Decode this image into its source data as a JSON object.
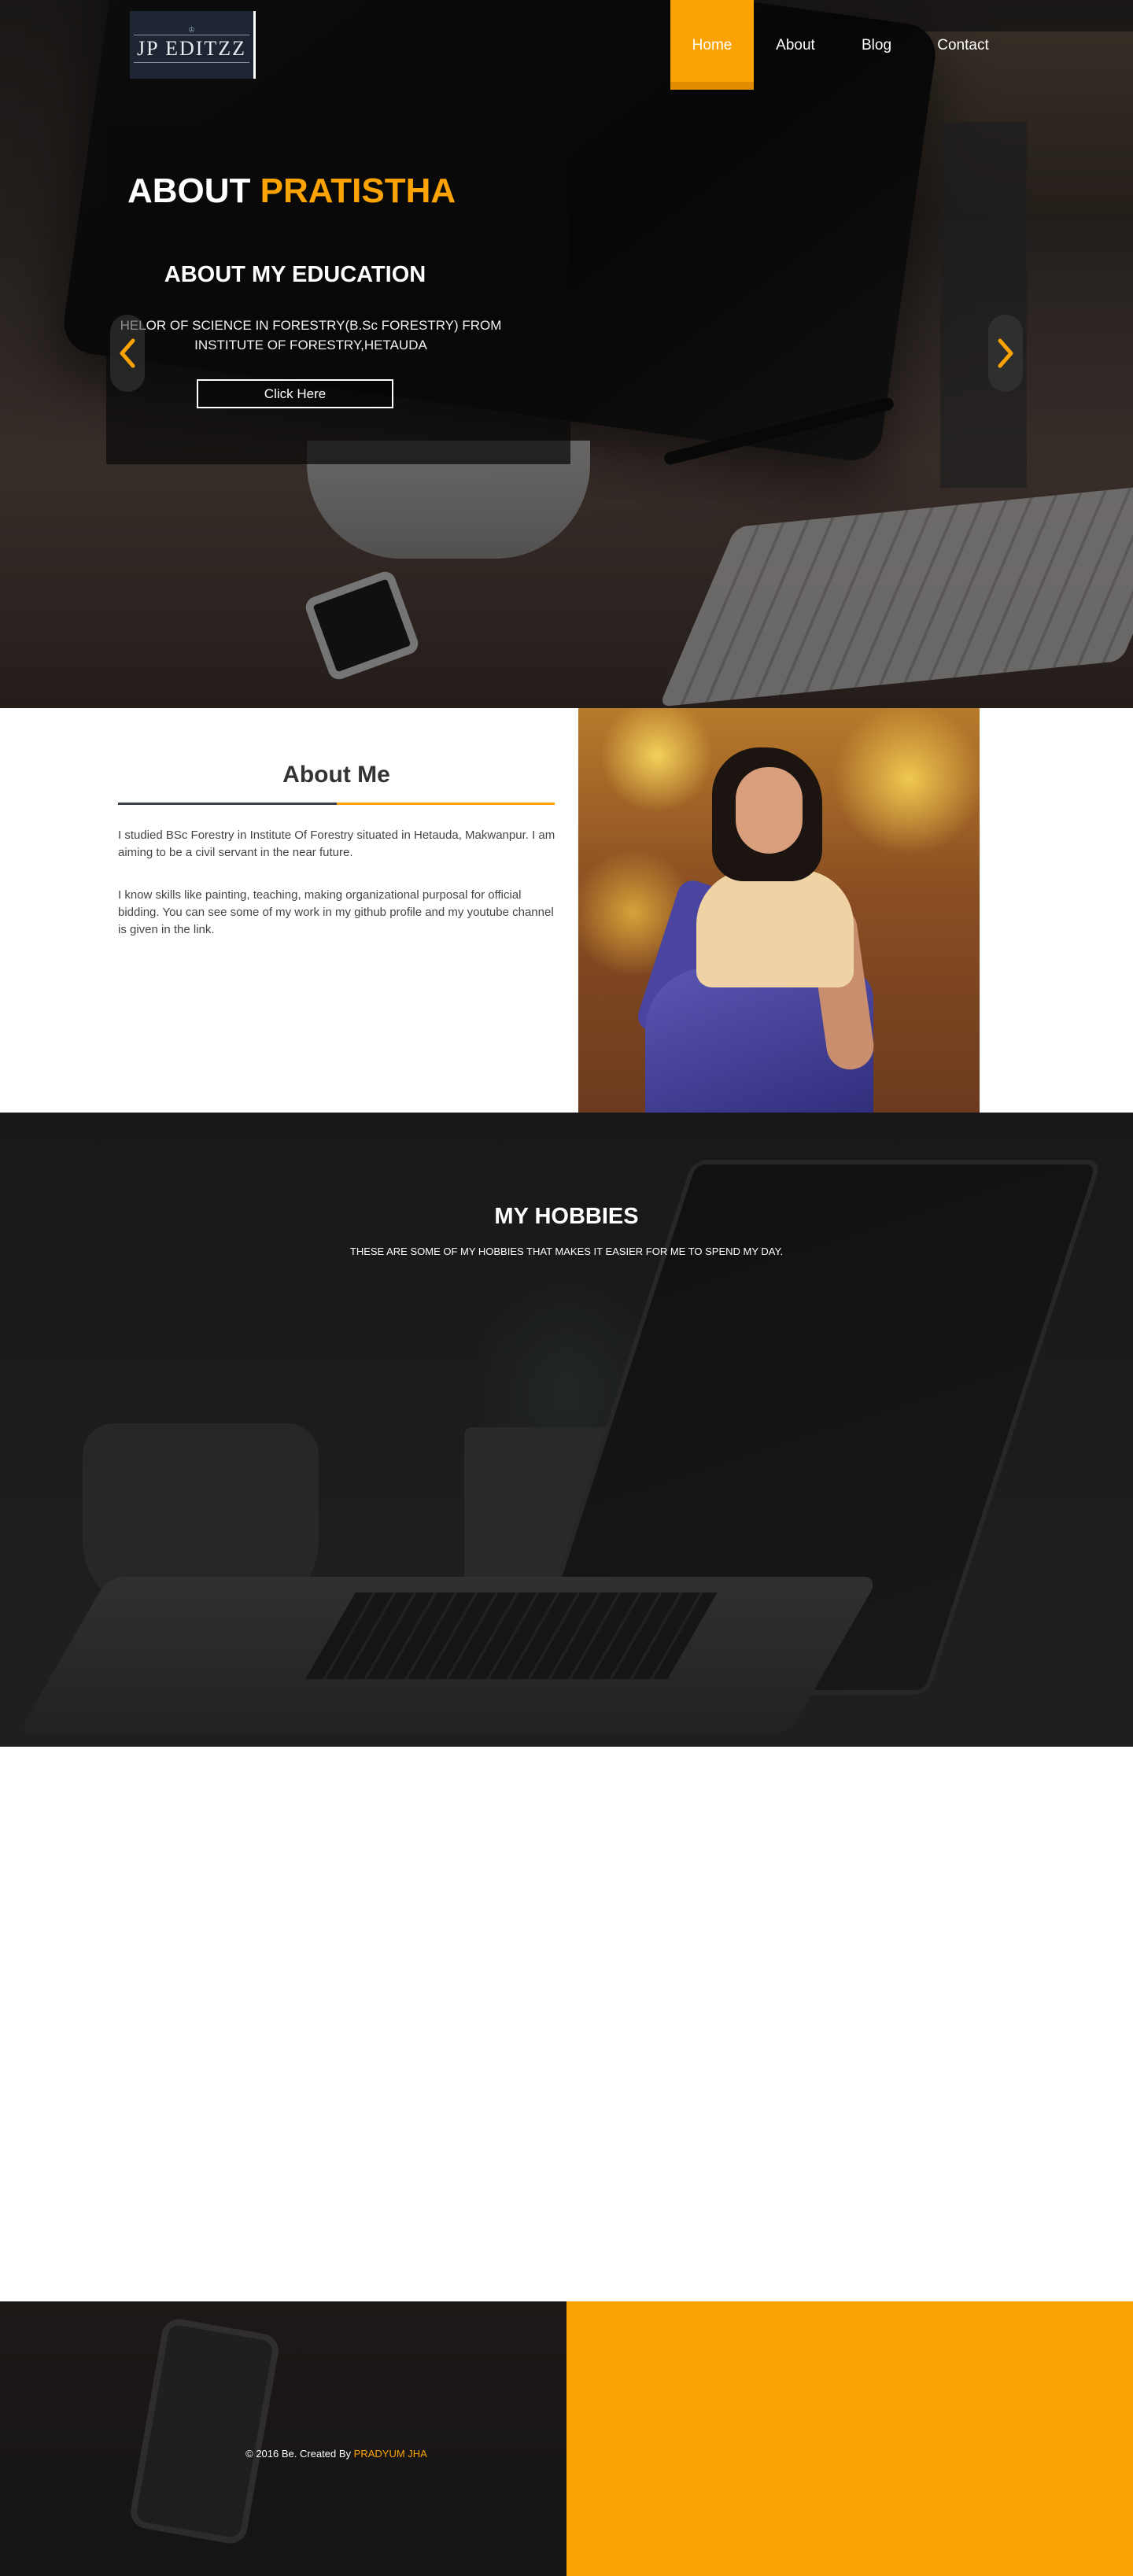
{
  "logo": {
    "text": "JP EDITZZ"
  },
  "nav": {
    "items": [
      "Home",
      "About",
      "Blog",
      "Contact"
    ],
    "active": "Home"
  },
  "hero": {
    "title_prefix": "ABOUT",
    "title_name": "PRATISTHA",
    "subtitle": "ABOUT MY EDUCATION",
    "text_line1": "HELOR OF SCIENCE IN FORESTRY(B.Sc FORESTRY) FROM",
    "text_line2": "INSTITUTE OF FORESTRY,HETAUDA",
    "button_label": "Click Here"
  },
  "about": {
    "title": "About Me",
    "paragraph1": "I studied BSc Forestry in Institute Of Forestry situated in Hetauda, Makwanpur. I am aiming to be a civil servant in the near future.",
    "paragraph2": "I know skills like painting, teaching, making organizational purposal for official bidding. You can see some of my work in my github profile and my youtube channel is given in the link."
  },
  "hobbies": {
    "title": "MY HOBBIES",
    "subtitle": "THESE ARE SOME OF MY HOBBIES THAT MAKES IT EASIER FOR ME TO SPEND MY DAY."
  },
  "footer": {
    "copyright_prefix": "© 2016 Be. Created By",
    "author": "PRADYUM JHA"
  },
  "colors": {
    "accent": "#fca304",
    "dark": "#1e1e20"
  },
  "icons": {
    "prev": "chevron-left-icon",
    "next": "chevron-right-icon"
  }
}
